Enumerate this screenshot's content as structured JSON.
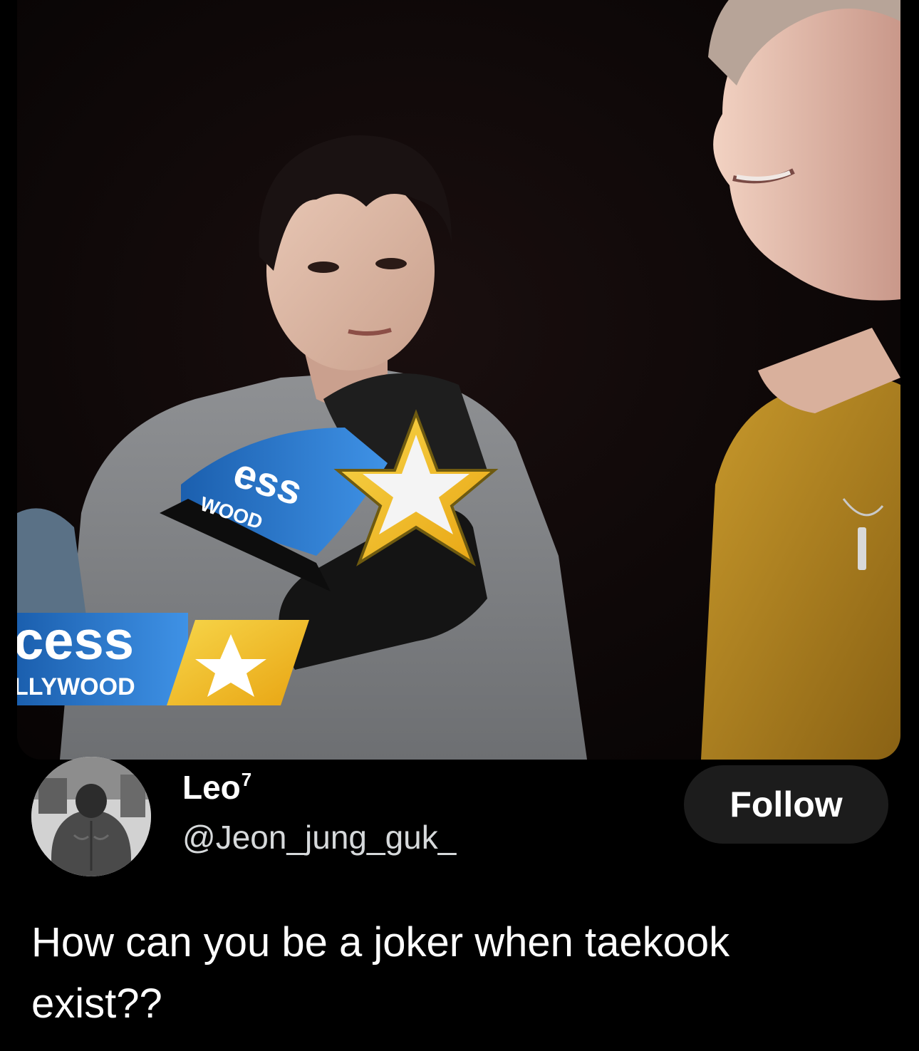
{
  "media": {
    "type": "video-still",
    "overlay_logo_lines": [
      "cess",
      "LLYWOOD"
    ],
    "mic_flag_lines": [
      "ess",
      "WOOD"
    ]
  },
  "author": {
    "display_name": "Leo",
    "name_superscript": "7",
    "handle": "@Jeon_jung_guk_"
  },
  "actions": {
    "follow_label": "Follow"
  },
  "tweet": {
    "text": "How can you be a joker when taekook\nexist??"
  },
  "colors": {
    "background": "#000000",
    "follow_button_bg": "#1c1c1c",
    "text_primary": "#ffffff",
    "text_secondary": "#d6d9db",
    "logo_blue": "#1f73c8",
    "logo_yellow": "#f2c424"
  },
  "icons": [
    "star-logo-icon"
  ]
}
